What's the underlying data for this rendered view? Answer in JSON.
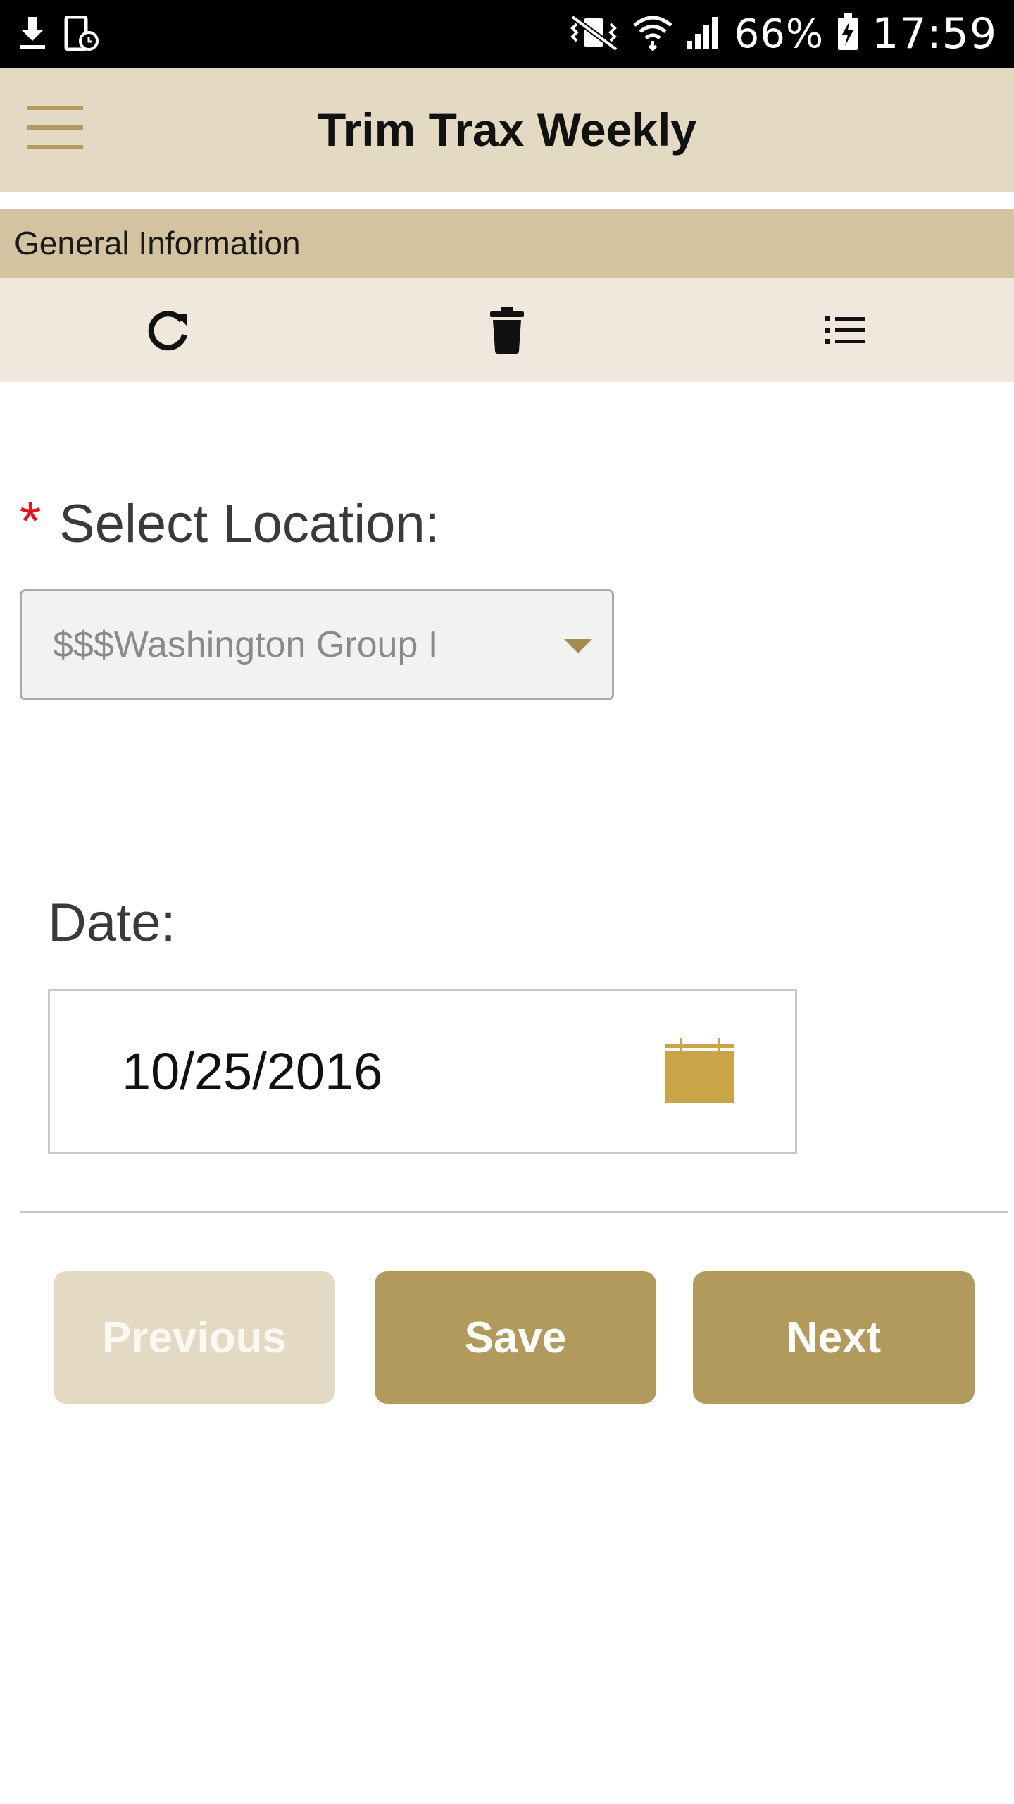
{
  "status_bar": {
    "battery": "66%",
    "time": "17:59",
    "icons_left": [
      "download-icon",
      "device-alarm-icon"
    ],
    "icons_right": [
      "vibrate-icon",
      "wifi-icon",
      "signal-icon",
      "battery-charging-icon"
    ]
  },
  "app_bar": {
    "title": "Trim Trax Weekly",
    "menu_icon": "hamburger-menu-icon"
  },
  "section": {
    "title": "General Information"
  },
  "toolbar": {
    "icons": [
      "refresh-icon",
      "trash-icon",
      "list-icon"
    ]
  },
  "form": {
    "location": {
      "required_marker": "*",
      "label": "Select Location:",
      "selected_value": "$$$Washington Group I"
    },
    "date": {
      "label": "Date:",
      "value": "10/25/2016",
      "icon": "calendar-icon"
    }
  },
  "buttons": {
    "previous": "Previous",
    "save": "Save",
    "next": "Next"
  },
  "colors": {
    "app_bar_bg": "#e4dac3",
    "section_bg": "#d3c3a0",
    "toolbar_bg": "#f0e8dc",
    "accent": "#b29a5c",
    "disabled_button": "#e4dac3",
    "calendar": "#c9a449",
    "required": "#e41616"
  }
}
